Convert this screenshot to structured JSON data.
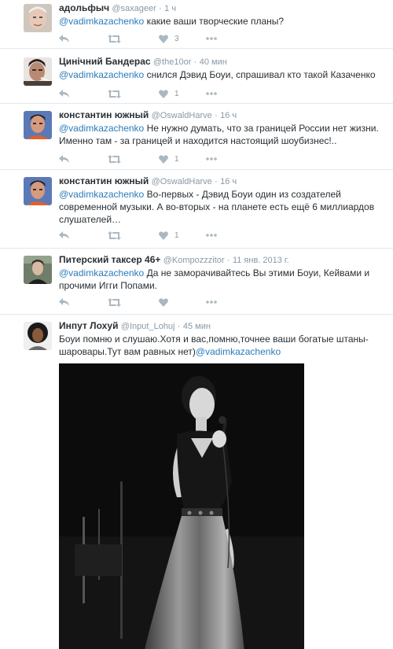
{
  "tweets": [
    {
      "name": "адольфыч",
      "handle": "@saxageer",
      "time": "1 ч",
      "mention": "@vadimkazachenko",
      "text": " какие ваши творческие планы?",
      "likes": "3"
    },
    {
      "name": "Цинічний Бандерас",
      "handle": "@the10or",
      "time": "40 мин",
      "mention": "@vadimkazachenko",
      "text": " снился Дэвид Боуи, спрашивал кто такой Казаченко",
      "likes": "1"
    },
    {
      "name": "константин южный",
      "handle": "@OswaldHarve",
      "time": "16 ч",
      "mention": "@vadimkazachenko",
      "text": " Не нужно думать, что за границей России нет жизни. Именно там - за границей и находится настоящий шоубизнес!..",
      "likes": "1"
    },
    {
      "name": "константин южный",
      "handle": "@OswaldHarve",
      "time": "16 ч",
      "mention": "@vadimkazachenko",
      "text": " Во-первых - Дэвид Боуи один из создателей современной музыки. А во-вторых - на планете есть ещё 6 миллиардов слушателей…",
      "likes": "1"
    },
    {
      "name": "Питерский таксер 46+",
      "handle": "@Kompozzzitor",
      "time": "11 янв. 2013 г.",
      "mention": "@vadimkazachenko",
      "text": " Да не заморачивайтесь Вы этими Боуи, Кейвами и прочими Игги Попами.",
      "likes": ""
    },
    {
      "name": "Инпут Лохуй",
      "handle": "@Input_Lohuj",
      "time": "45 мин",
      "text_before": "Боуи помню и слушаю.Хотя и вас,помню,точнее ваши богатые штаны-шаровары.Тут вам равных нет)",
      "mention": "@vadimkazachenko"
    }
  ],
  "dot": "·",
  "colors": {
    "link": "#2b7bb9",
    "meta": "#8899a6",
    "icon": "#aab8c2",
    "divider": "#e1e8ed"
  },
  "icons": [
    "reply-icon",
    "retweet-icon",
    "heart-icon",
    "more-icon"
  ]
}
